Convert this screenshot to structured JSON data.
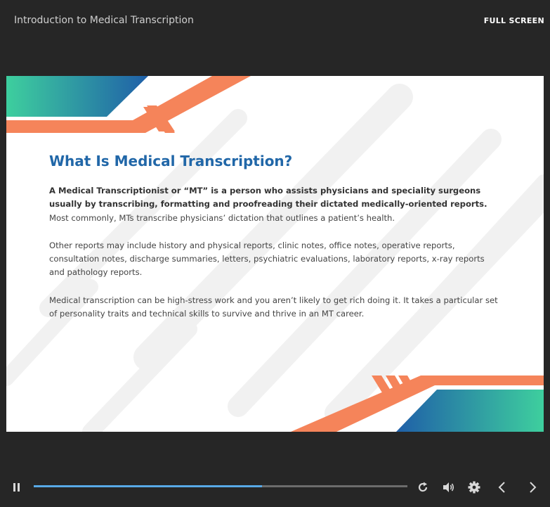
{
  "header": {
    "course_title": "Introduction to Medical Transcription",
    "fullscreen_label": "FULL SCREEN"
  },
  "slide": {
    "heading": "What Is Medical Transcription?",
    "paragraph1_bold": "A Medical Transcriptionist or “MT” is a person who assists physicians and speciality surgeons usually by transcribing, formatting and proofreading their dictated medically-oriented reports.",
    "paragraph1_rest": " Most commonly, MTs transcribe physicians’ dictation that outlines a patient’s health.",
    "paragraph2": "Other reports may include history and physical reports, clinic notes, office notes, operative reports, consultation notes, discharge summaries, letters, psychiatric evaluations, laboratory reports, x-ray reports and pathology reports.",
    "paragraph3": "Medical transcription can be high-stress work and you aren’t likely to get rich doing it. It takes a particular set of personality traits and technical skills to survive and thrive in an MT career."
  },
  "controls": {
    "progress": 0.61,
    "icons": [
      "pause-icon",
      "replay-icon",
      "volume-icon",
      "gear-icon",
      "chevron-left-icon",
      "chevron-right-icon"
    ]
  },
  "colors": {
    "background": "#262626",
    "accent_orange": "#f5845a",
    "teal": "#3ecf9e",
    "blue": "#1f5fa8",
    "heading": "#2167a8",
    "progress_fill": "#58a9e6",
    "progress_track": "#6c6c6c"
  }
}
